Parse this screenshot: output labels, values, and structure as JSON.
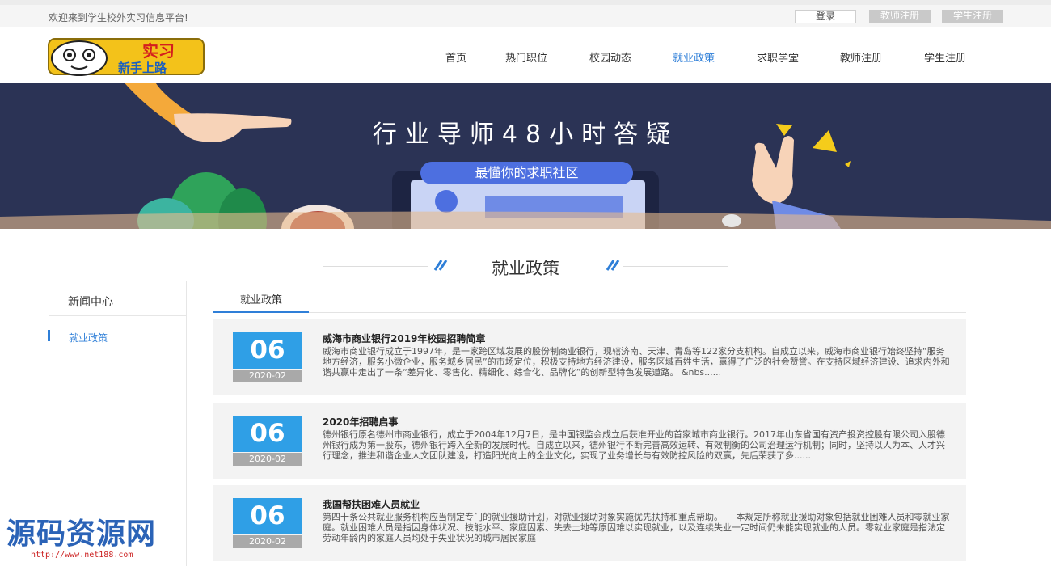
{
  "topbar": {
    "welcome": "欢迎来到学生校外实习信息平台!",
    "login": "登录",
    "teacher_register": "教师注册",
    "student_register": "学生注册"
  },
  "logo": {
    "text_top": "实习",
    "text_bottom": "新手上路"
  },
  "nav": [
    {
      "label": "首页"
    },
    {
      "label": "热门职位"
    },
    {
      "label": "校园动态"
    },
    {
      "label": "就业政策",
      "active": true
    },
    {
      "label": "求职学堂"
    },
    {
      "label": "教师注册"
    },
    {
      "label": "学生注册"
    }
  ],
  "banner": {
    "title": "行业导师48小时答疑",
    "pill": "最懂你的求职社区"
  },
  "section_title": "就业政策",
  "sidebar": {
    "heading": "新闻中心",
    "items": [
      {
        "label": "就业政策"
      }
    ]
  },
  "tab": {
    "label": "就业政策"
  },
  "articles": [
    {
      "day": "06",
      "ym": "2020-02",
      "title": "威海市商业银行2019年校园招聘简章",
      "summary": "威海市商业银行成立于1997年，是一家跨区域发展的股份制商业银行，现辖济南、天津、青岛等122家分支机构。自成立以来，威海市商业银行始终坚持“服务地方经济，服务小微企业，服务城乡居民”的市场定位，积极支持地方经济建设，服务区域百姓生活，赢得了广泛的社会赞誉。在支持区域经济建设、追求内外和谐共赢中走出了一条“差异化、零售化、精细化、综合化、品牌化”的创新型特色发展道路。    &nbs......"
    },
    {
      "day": "06",
      "ym": "2020-02",
      "title": "2020年招聘启事",
      "summary": "德州银行原名德州市商业银行，成立于2004年12月7日，是中国银监会成立后获准开业的首家城市商业银行。2017年山东省国有资产投资控股有限公司入股德州银行成为第一股东，德州银行跨入全新的发展时代。自成立以来，德州银行不断完善高效运转、有效制衡的公司治理运行机制；同时，坚持以人为本、人才兴行理念，推进和谐企业人文团队建设，打造阳光向上的企业文化，实现了业务增长与有效防控风险的双赢，先后荣获了多......"
    },
    {
      "day": "06",
      "ym": "2020-02",
      "title": "我国帮扶困难人员就业",
      "summary": "第四十条公共就业服务机构应当制定专门的就业援助计划，对就业援助对象实施优先扶持和重点帮助。　　本规定所称就业援助对象包括就业困难人员和零就业家庭。就业困难人员是指因身体状况、技能水平、家庭因素、失去土地等原因难以实现就业，以及连续失业一定时间仍未能实现就业的人员。零就业家庭是指法定劳动年龄内的家庭人员均处于失业状况的城市居民家庭"
    }
  ],
  "watermark": {
    "text": "源码资源网",
    "url": "http://www.net188.com"
  },
  "colors": {
    "accent": "#2f7fd8",
    "date_blue": "#2f9fe6",
    "banner_bg": "#2b3355",
    "pill": "#4d6fe0"
  }
}
